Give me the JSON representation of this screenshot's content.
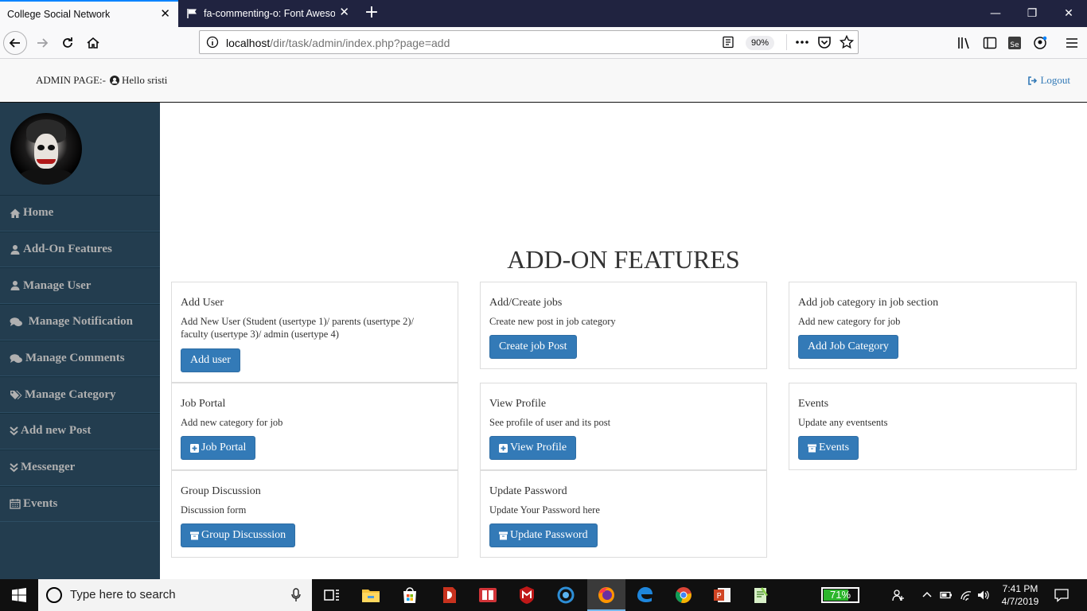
{
  "browser": {
    "tabs": [
      {
        "title": "College Social Network",
        "active": true
      },
      {
        "title": "fa-commenting-o: Font Awesome",
        "active": false
      }
    ],
    "url_host": "localhost",
    "url_path": "/dir/task/admin/index.php?page=add",
    "zoom": "90%"
  },
  "header": {
    "admin_label": "ADMIN PAGE:-",
    "greeting": "Hello sristi",
    "logout": "Logout"
  },
  "sidebar": {
    "items": [
      {
        "label": "Home",
        "icon": "home-icon"
      },
      {
        "label": "Add-On Features",
        "icon": "user-icon"
      },
      {
        "label": "Manage User",
        "icon": "user-icon"
      },
      {
        "label": " Manage Notification",
        "icon": "comments-icon"
      },
      {
        "label": "Manage Comments",
        "icon": "comments-icon"
      },
      {
        "label": "Manage Category",
        "icon": "tags-icon"
      },
      {
        "label": "Add new Post",
        "icon": "double-chevron-down-icon"
      },
      {
        "label": "Messenger",
        "icon": "double-chevron-down-icon"
      },
      {
        "label": "Events",
        "icon": "calendar-icon"
      }
    ]
  },
  "main": {
    "title": "ADD-ON FEATURES",
    "cards": [
      {
        "title": "Add User",
        "desc": "Add New User (Student (usertype 1)/ parents (usertype 2)/ faculty (usertype 3)/ admin (usertype 4)",
        "button": "Add user",
        "button_icon": ""
      },
      {
        "title": "Add/Create jobs",
        "desc": "Create new post in job category",
        "button": "Create job Post",
        "button_icon": ""
      },
      {
        "title": "Add job category in job section",
        "desc": "Add new category for job",
        "button": "Add Job Category",
        "button_icon": ""
      },
      {
        "title": "Job Portal",
        "desc": "Add new category for job",
        "button": "Job Portal",
        "button_icon": "plus-square-icon"
      },
      {
        "title": "View Profile",
        "desc": "See profile of user and its post",
        "button": "View Profile",
        "button_icon": "plus-square-icon"
      },
      {
        "title": "Events",
        "desc": "Update any eventsents",
        "button": "Events",
        "button_icon": "archive-icon"
      },
      {
        "title": "Group Discussion",
        "desc": "Discussion form",
        "button": "Group Discusssion",
        "button_icon": "archive-icon"
      },
      {
        "title": "Update Password",
        "desc": "Update Your Password here",
        "button": "Update Password",
        "button_icon": "archive-icon"
      }
    ]
  },
  "taskbar": {
    "search_placeholder": "Type here to search",
    "battery": "71%",
    "battery_level": 0.71,
    "time": "7:41 PM",
    "date": "4/7/2019"
  },
  "colors": {
    "sidebar_bg": "#233d4f",
    "primary_button": "#337ab7",
    "link": "#337ab7"
  }
}
